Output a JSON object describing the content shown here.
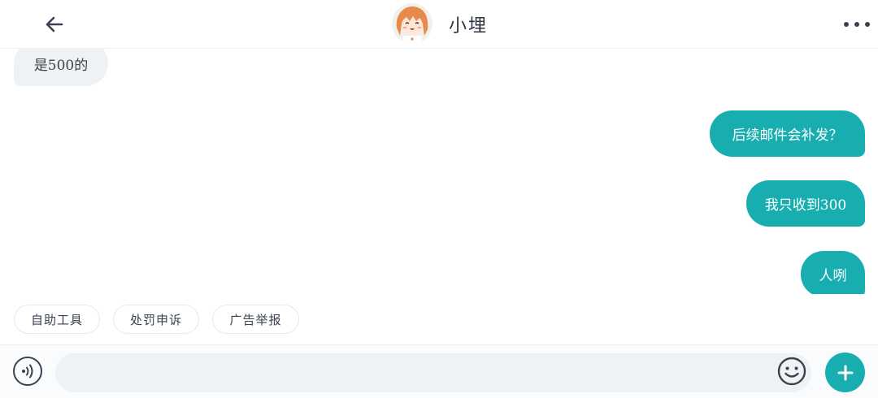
{
  "header": {
    "title": "小埋",
    "back_icon": "arrow-left-icon",
    "more_icon": "more-horizontal-icon"
  },
  "messages": [
    {
      "direction": "incoming",
      "text": "是500的"
    },
    {
      "direction": "outgoing",
      "text": "后续邮件会补发？"
    },
    {
      "direction": "outgoing",
      "text": "我只收到300"
    },
    {
      "direction": "outgoing",
      "text": "人咧"
    }
  ],
  "quick_actions": [
    {
      "label": "自助工具"
    },
    {
      "label": "处罚申诉"
    },
    {
      "label": "广告举报"
    }
  ],
  "input": {
    "value": "",
    "placeholder": "",
    "voice_icon": "voice-icon",
    "emoji_icon": "emoji-icon",
    "plus_icon": "plus-icon"
  },
  "colors": {
    "accent": "#18aeb0",
    "incoming_bubble": "#eff2f5",
    "text": "#3a4250"
  }
}
